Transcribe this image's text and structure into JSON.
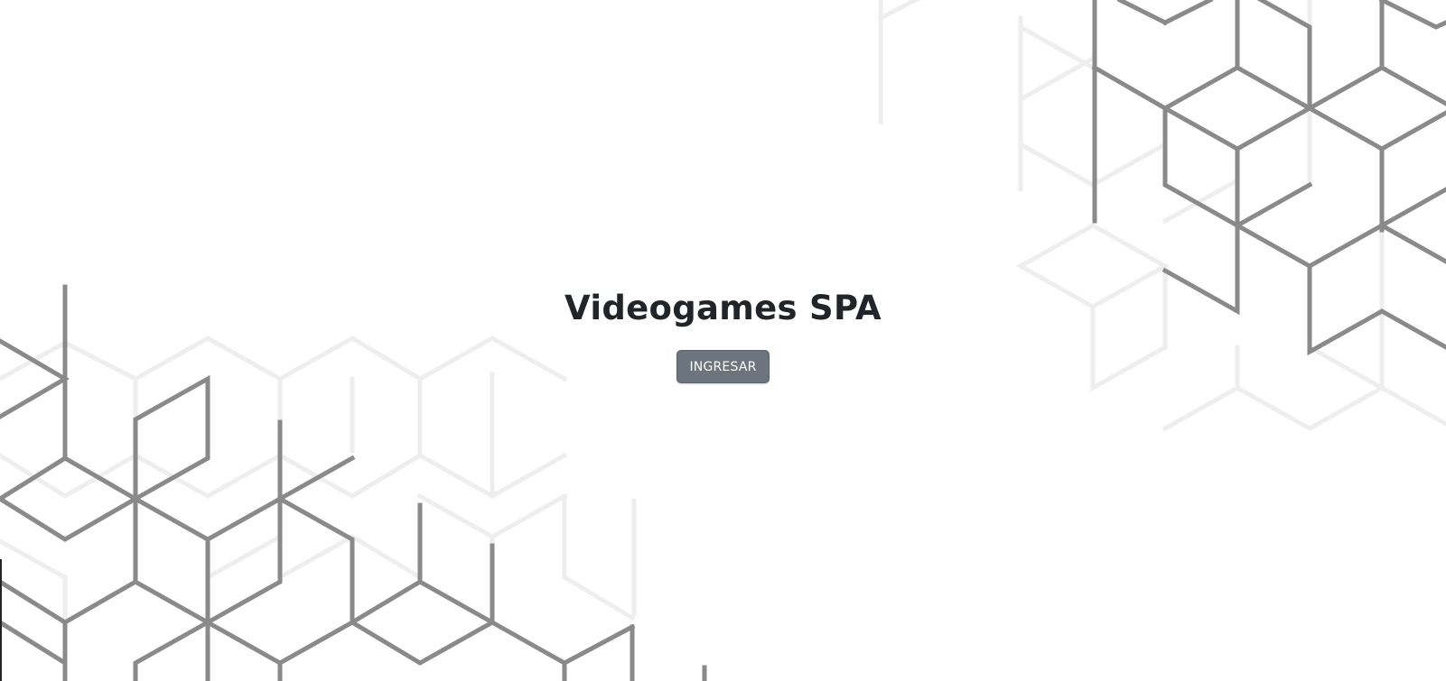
{
  "hero": {
    "title": "Videogames SPA",
    "enter_button_label": "INGRESAR"
  },
  "theme": {
    "button_color": "#6c757d",
    "title_color": "#212529",
    "pattern_color": "#8a8a8a",
    "pattern_faint_color": "#eeeeee"
  },
  "background": {
    "pattern": "hexagonal-cube-lines"
  }
}
